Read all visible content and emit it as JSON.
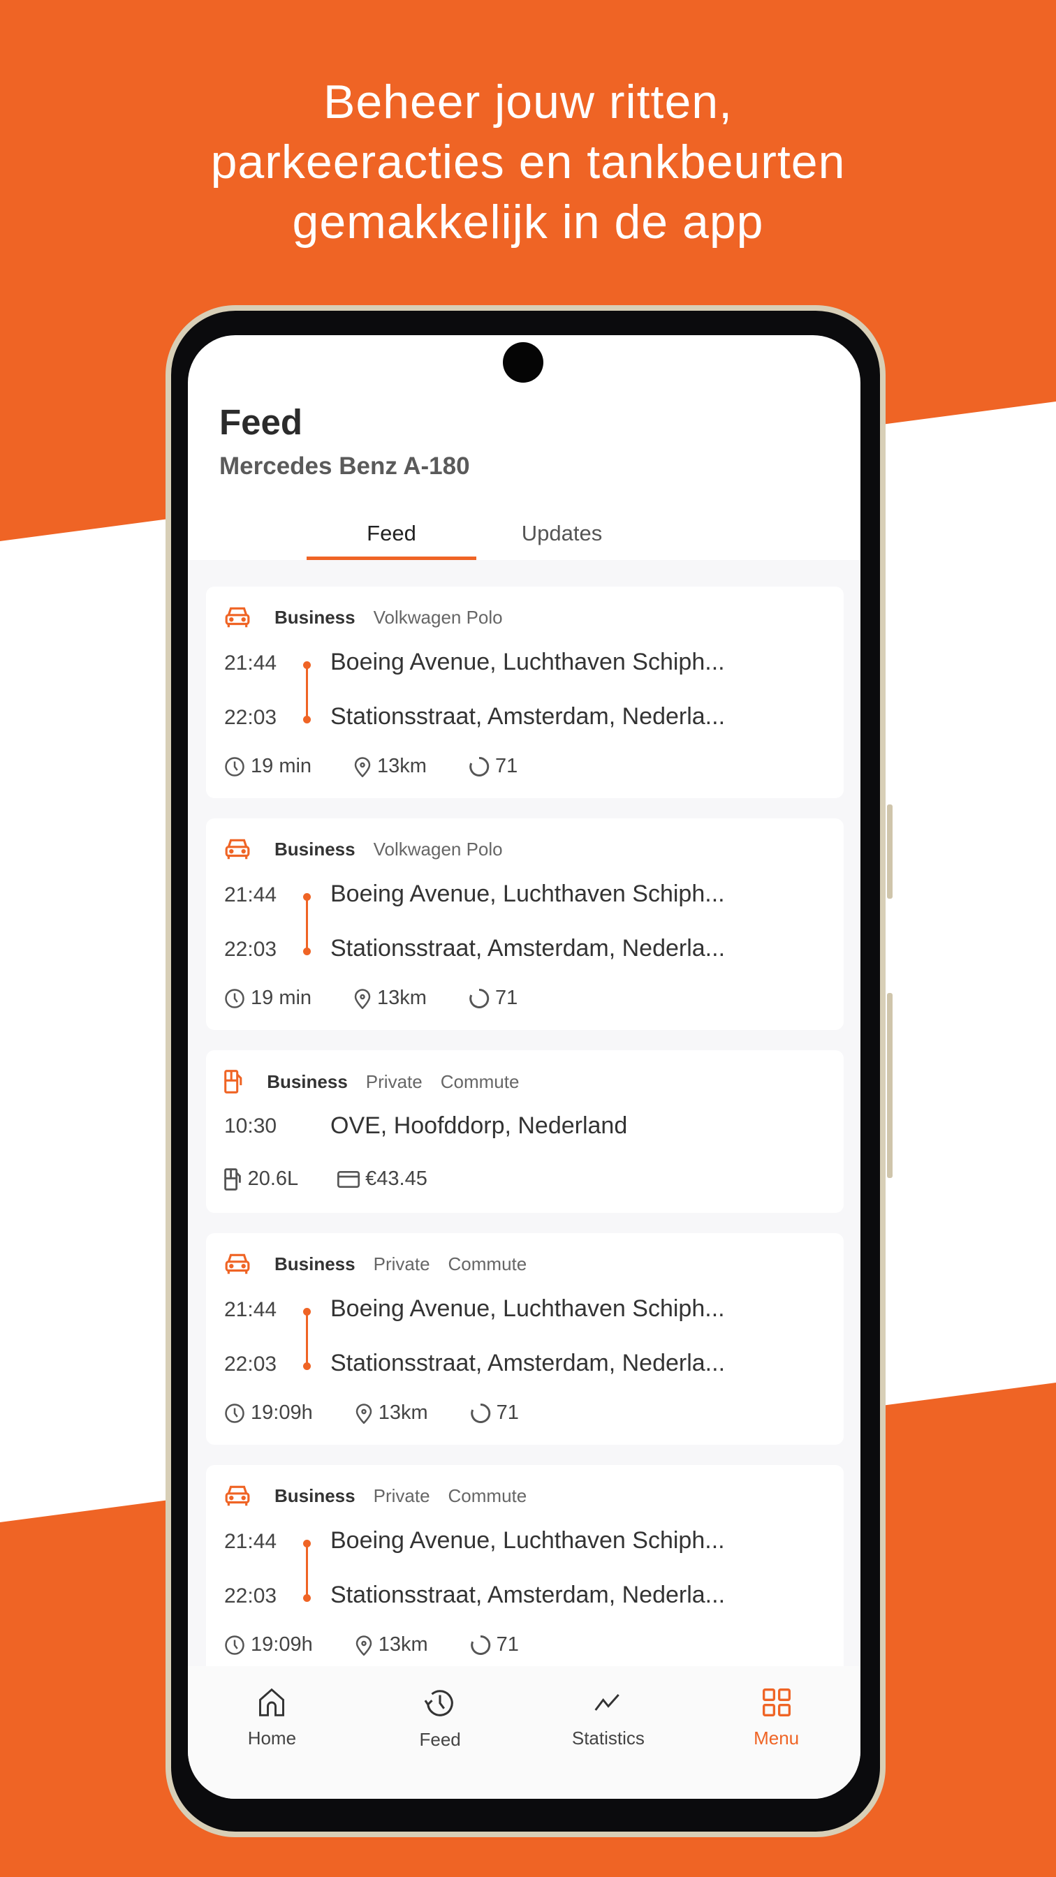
{
  "headline": [
    "Beheer jouw ritten,",
    "parkeeracties en tankbeurten",
    "gemakkelijk in de app"
  ],
  "colors": {
    "accent": "#EF6425",
    "background": "#EF6425"
  },
  "header": {
    "title": "Feed",
    "subtitle": "Mercedes Benz A-180"
  },
  "tabs": [
    {
      "label": "Feed",
      "active": true
    },
    {
      "label": "Updates",
      "active": false
    }
  ],
  "feed": [
    {
      "type": "trip",
      "icon": "car-icon",
      "tags": [
        "Business",
        "Volkwagen Polo"
      ],
      "start_time": "21:44",
      "start_address": "Boeing Avenue, Luchthaven Schiph...",
      "end_time": "22:03",
      "end_address": "Stationsstraat, Amsterdam, Nederla...",
      "duration": "19 min",
      "distance": "13km",
      "score": "71"
    },
    {
      "type": "trip",
      "icon": "car-icon",
      "tags": [
        "Business",
        "Volkwagen Polo"
      ],
      "start_time": "21:44",
      "start_address": "Boeing Avenue, Luchthaven Schiph...",
      "end_time": "22:03",
      "end_address": "Stationsstraat, Amsterdam, Nederla...",
      "duration": "19 min",
      "distance": "13km",
      "score": "71"
    },
    {
      "type": "fuel",
      "icon": "fuel-icon",
      "tags": [
        "Business",
        "Private",
        "Commute"
      ],
      "time": "10:30",
      "address": "OVE, Hoofddorp, Nederland",
      "liters": "20.6L",
      "amount": "€43.45"
    },
    {
      "type": "trip",
      "icon": "car-icon",
      "tags": [
        "Business",
        "Private",
        "Commute"
      ],
      "start_time": "21:44",
      "start_address": "Boeing Avenue, Luchthaven Schiph...",
      "end_time": "22:03",
      "end_address": "Stationsstraat, Amsterdam, Nederla...",
      "duration": "19:09h",
      "distance": "13km",
      "score": "71"
    },
    {
      "type": "trip",
      "icon": "car-icon",
      "tags": [
        "Business",
        "Private",
        "Commute"
      ],
      "start_time": "21:44",
      "start_address": "Boeing Avenue, Luchthaven Schiph...",
      "end_time": "22:03",
      "end_address": "Stationsstraat, Amsterdam, Nederla...",
      "duration": "19:09h",
      "distance": "13km",
      "score": "71"
    }
  ],
  "nav": [
    {
      "label": "Home",
      "icon": "home-icon",
      "active": false
    },
    {
      "label": "Feed",
      "icon": "history-icon",
      "active": false
    },
    {
      "label": "Statistics",
      "icon": "chart-line-icon",
      "active": false
    },
    {
      "label": "Menu",
      "icon": "grid-icon",
      "active": true
    }
  ]
}
